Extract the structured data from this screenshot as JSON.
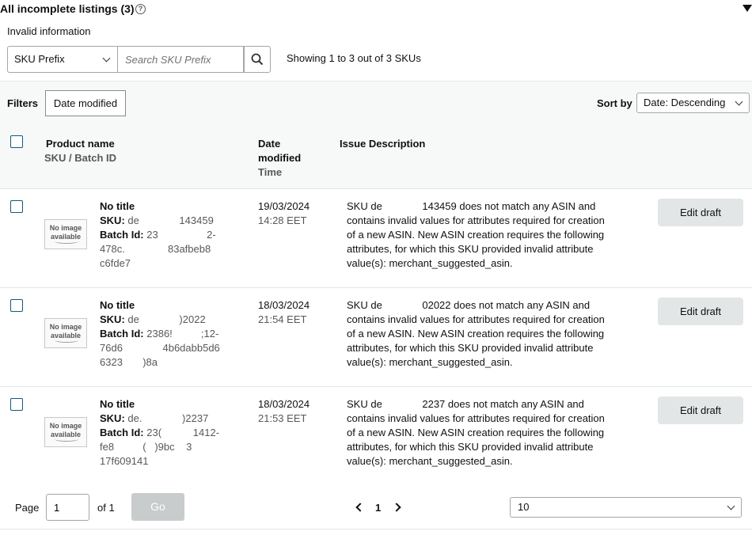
{
  "header": {
    "title": "All incomplete listings (3)",
    "help_icon": "?",
    "subtitle": "Invalid information"
  },
  "search": {
    "prefix_select": "SKU Prefix",
    "placeholder": "Search SKU Prefix",
    "showing": "Showing 1 to 3 out of 3 SKUs"
  },
  "filters": {
    "label": "Filters",
    "chip": "Date modified",
    "sort_label": "Sort by",
    "sort_value": "Date: Descending"
  },
  "columns": {
    "product_name": "Product name",
    "sku_batch": "SKU / Batch ID",
    "date_modified": "Date modified",
    "time": "Time",
    "issue": "Issue Description"
  },
  "rows": [
    {
      "title": "No title",
      "img_line1": "No image",
      "img_line2": "available",
      "sku_label": "SKU:",
      "sku_value": "de              143459",
      "batch_label": "Batch Id:",
      "batch_value": "23                 2-",
      "batch_line2": "478c.               83afbeb8",
      "batch_line3": "c6fde7",
      "date": "19/03/2024",
      "time": "14:28 EET",
      "issue": "SKU de              143459 does not match any ASIN and contains invalid values for attributes required for creation of a new ASIN. New ASIN creation requires the following attributes, for which this SKU provided invalid attribute value(s): merchant_suggested_asin.",
      "edit": "Edit draft"
    },
    {
      "title": "No title",
      "img_line1": "No image",
      "img_line2": "available",
      "sku_label": "SKU:",
      "sku_value": "de              )2022",
      "batch_label": "Batch Id:",
      "batch_value": "2386!          ;12-",
      "batch_line2": "76d6              4b6dabb5d6",
      "batch_line3": "6323       )8a",
      "date": "18/03/2024",
      "time": "21:54 EET",
      "issue": "SKU de              02022 does not match any ASIN and contains invalid values for attributes required for creation of a new ASIN. New ASIN creation requires the following attributes, for which this SKU provided invalid attribute value(s): merchant_suggested_asin.",
      "edit": "Edit draft"
    },
    {
      "title": "No title",
      "img_line1": "No image",
      "img_line2": "available",
      "sku_label": "SKU:",
      "sku_value": "de.              )2237",
      "batch_label": "Batch Id:",
      "batch_value": "23(           1412-",
      "batch_line2": "fe8          (   )9bc    3",
      "batch_line3": "17f609141",
      "date": "18/03/2024",
      "time": "21:53 EET",
      "issue": "SKU de              2237 does not match any ASIN and contains invalid values for attributes required for creation of a new ASIN. New ASIN creation requires the following attributes, for which this SKU provided invalid attribute value(s): merchant_suggested_asin.",
      "edit": "Edit draft"
    }
  ],
  "pagination": {
    "page_label": "Page",
    "page_value": "1",
    "of_label": "of 1",
    "go_label": "Go",
    "current": "1",
    "per_page": "10"
  }
}
